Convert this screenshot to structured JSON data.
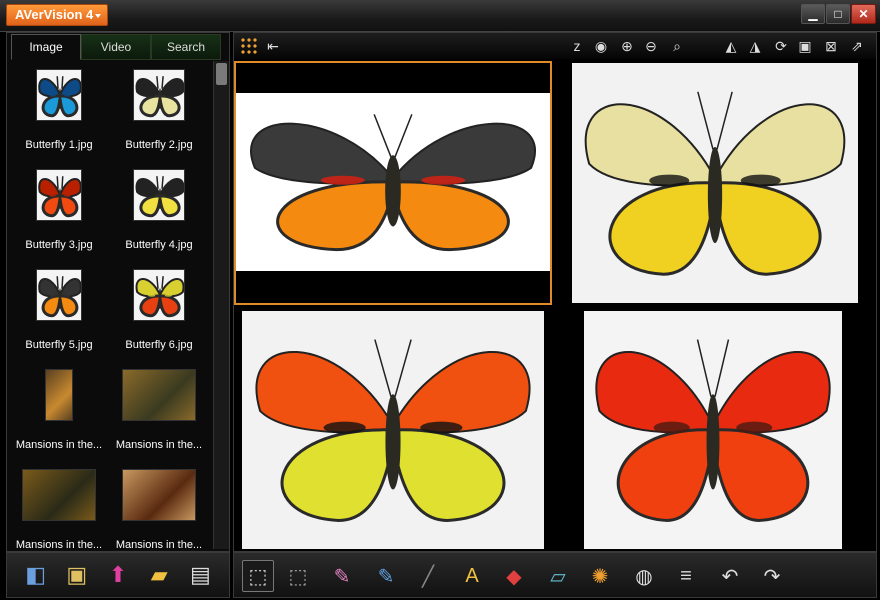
{
  "app": {
    "title": "AVerVision 4"
  },
  "window_buttons": {
    "minimize": "▁",
    "maximize": "□",
    "close": "✕"
  },
  "tabs": [
    {
      "label": "Image",
      "active": true
    },
    {
      "label": "Video",
      "active": false
    },
    {
      "label": "Search",
      "active": false
    }
  ],
  "thumbnails": [
    {
      "caption": "Butterfly 1.jpg",
      "colors": [
        "#1a9ad8",
        "#0c4a88"
      ]
    },
    {
      "caption": "Butterfly 2.jpg",
      "colors": [
        "#e8e4a0",
        "#222"
      ]
    },
    {
      "caption": "Butterfly 3.jpg",
      "colors": [
        "#f04a10",
        "#b82000"
      ]
    },
    {
      "caption": "Butterfly 4.jpg",
      "colors": [
        "#f0e040",
        "#222"
      ]
    },
    {
      "caption": "Butterfly 5.jpg",
      "colors": [
        "#f58a10",
        "#333"
      ]
    },
    {
      "caption": "Butterfly 6.jpg",
      "colors": [
        "#e84010",
        "#d8d030"
      ]
    },
    {
      "caption": "Mansions in the...",
      "colors": [
        "#5a4020",
        "#c88a30"
      ]
    },
    {
      "caption": "Mansions in the...",
      "colors": [
        "#8a6a2a",
        "#3a3a20"
      ]
    },
    {
      "caption": "Mansions in the...",
      "colors": [
        "#7a5a1a",
        "#2a2a18"
      ]
    },
    {
      "caption": "Mansions in the...",
      "colors": [
        "#c89860",
        "#5a2a10"
      ]
    }
  ],
  "left_toolbar": [
    {
      "name": "compare-icon",
      "glyph": "◧",
      "color": "#6aa0e0"
    },
    {
      "name": "image-search-icon",
      "glyph": "▣",
      "color": "#e0c060"
    },
    {
      "name": "upload-icon",
      "glyph": "⬆",
      "color": "#e040a0"
    },
    {
      "name": "new-folder-icon",
      "glyph": "▰",
      "color": "#f0c040"
    },
    {
      "name": "properties-icon",
      "glyph": "▤",
      "color": "#ddd"
    }
  ],
  "main_toolbar": {
    "left": [
      {
        "name": "grid-view-icon",
        "glyph": ""
      },
      {
        "name": "import-icon",
        "glyph": "⇤"
      }
    ],
    "right": [
      {
        "name": "sleep-icon",
        "glyph": "z"
      },
      {
        "name": "preview-icon",
        "glyph": "◉"
      },
      {
        "name": "zoom-in-icon",
        "glyph": "⊕"
      },
      {
        "name": "zoom-out-icon",
        "glyph": "⊖"
      },
      {
        "name": "zoom-fit-icon",
        "glyph": "⌕"
      },
      {
        "name": "flip-horizontal-icon",
        "glyph": "◭"
      },
      {
        "name": "flip-vertical-icon",
        "glyph": "◮"
      },
      {
        "name": "rotate-icon",
        "glyph": "⟳"
      },
      {
        "name": "fit-screen-icon",
        "glyph": "▣"
      },
      {
        "name": "close-pane-icon",
        "glyph": "⊠"
      },
      {
        "name": "export-icon",
        "glyph": "⇗"
      }
    ]
  },
  "panes": [
    {
      "name": "pane-butterfly-1",
      "selected": true,
      "wing": "#f58a10",
      "top_wing": "#3a3a3a",
      "accent": "#e02010",
      "bg": "#ffffff"
    },
    {
      "name": "pane-butterfly-2",
      "selected": false,
      "wing": "#f0d020",
      "top_wing": "#e8e0a0",
      "accent": "#111",
      "bg": "#f2f2f2"
    },
    {
      "name": "pane-butterfly-3",
      "selected": false,
      "wing": "#e0e030",
      "top_wing": "#f05010",
      "accent": "#111",
      "bg": "#f2f2f2"
    },
    {
      "name": "pane-butterfly-4",
      "selected": false,
      "wing": "#f04010",
      "top_wing": "#e82a10",
      "accent": "#4a1a10",
      "bg": "#f4f4f4"
    }
  ],
  "bottom_toolbar": [
    {
      "name": "select-tool-icon",
      "glyph": "⬚",
      "color": "#ddd",
      "active": true
    },
    {
      "name": "area-select-icon",
      "glyph": "⬚",
      "color": "#aaa",
      "active": false
    },
    {
      "name": "pen-icon",
      "glyph": "✎",
      "color": "#e080c0",
      "active": false
    },
    {
      "name": "highlighter-icon",
      "glyph": "✎",
      "color": "#60a0e0",
      "active": false
    },
    {
      "name": "line-icon",
      "glyph": "╱",
      "color": "#888",
      "active": false
    },
    {
      "name": "text-icon",
      "glyph": "A",
      "color": "#f0c040",
      "active": false
    },
    {
      "name": "shapes-icon",
      "glyph": "◆",
      "color": "#e04040",
      "active": false
    },
    {
      "name": "eraser-icon",
      "glyph": "▱",
      "color": "#60c0d0",
      "active": false
    },
    {
      "name": "clear-icon",
      "glyph": "✺",
      "color": "#f0a030",
      "active": false
    },
    {
      "name": "palette-icon",
      "glyph": "◍",
      "color": "#ddd",
      "active": false
    },
    {
      "name": "line-width-icon",
      "glyph": "≡",
      "color": "#ddd",
      "active": false
    },
    {
      "name": "undo-icon",
      "glyph": "↶",
      "color": "#ddd",
      "active": false
    },
    {
      "name": "redo-icon",
      "glyph": "↷",
      "color": "#ddd",
      "active": false
    }
  ]
}
